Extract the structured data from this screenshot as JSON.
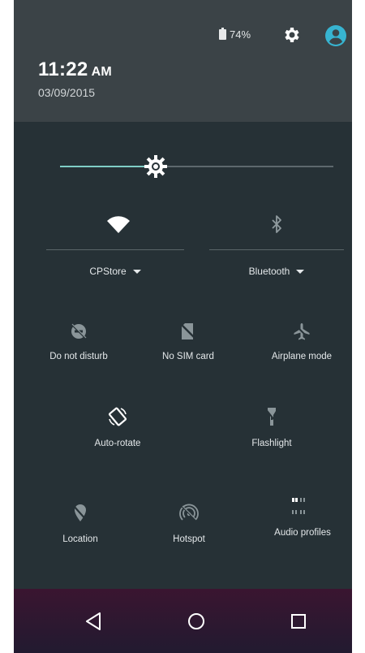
{
  "status": {
    "battery_text": "74%",
    "icons": [
      "battery-icon",
      "settings-icon",
      "account-icon"
    ]
  },
  "header": {
    "time": "11:22",
    "ampm": "AM",
    "date": "03/09/2015"
  },
  "brightness": {
    "level": 0.35,
    "accent_color": "#7fcdc6"
  },
  "dropdown_tiles": [
    {
      "id": "wifi",
      "label": "CPStore",
      "icon": "wifi-icon"
    },
    {
      "id": "bluetooth",
      "label": "Bluetooth",
      "icon": "bluetooth-icon"
    }
  ],
  "tiles": [
    {
      "id": "dnd",
      "label": "Do not disturb",
      "icon": "do-not-disturb-icon"
    },
    {
      "id": "sim",
      "label": "No SIM card",
      "icon": "no-sim-icon"
    },
    {
      "id": "airplane",
      "label": "Airplane mode",
      "icon": "airplane-icon"
    },
    {
      "id": "rotate",
      "label": "Auto-rotate",
      "icon": "auto-rotate-icon"
    },
    {
      "id": "flashlight",
      "label": "Flashlight",
      "icon": "flashlight-icon"
    },
    {
      "id": "location",
      "label": "Location",
      "icon": "location-icon"
    },
    {
      "id": "hotspot",
      "label": "Hotspot",
      "icon": "hotspot-icon"
    },
    {
      "id": "audio",
      "label": "Audio profiles",
      "icon": "audio-profiles-icon"
    }
  ],
  "navbar": {
    "icons": [
      "back-icon",
      "home-icon",
      "recents-icon"
    ]
  },
  "colors": {
    "header_bg": "#3b4347",
    "panel_bg": "#263136",
    "account_accent": "#37b4d1"
  }
}
